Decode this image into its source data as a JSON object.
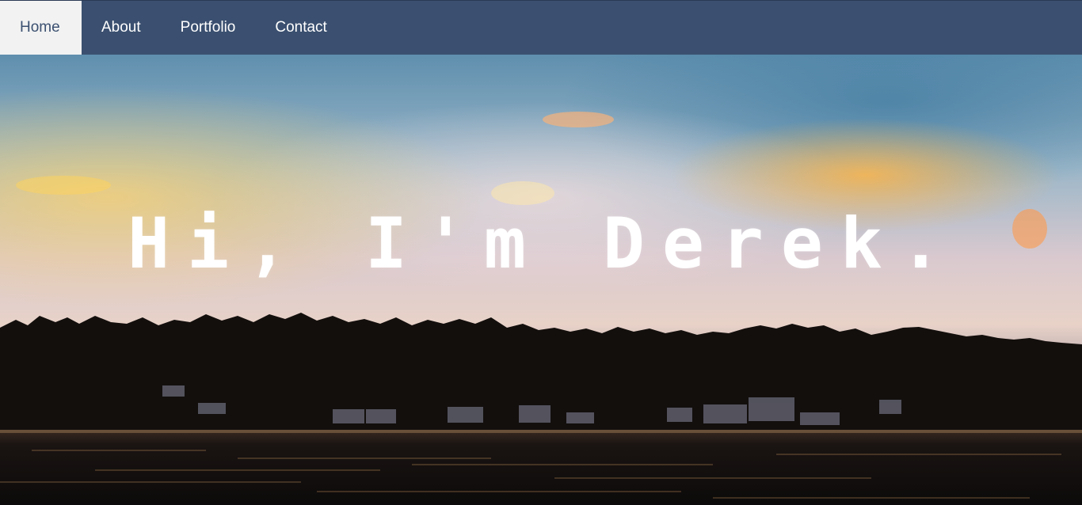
{
  "nav": {
    "items": [
      {
        "label": "Home",
        "active": true
      },
      {
        "label": "About",
        "active": false
      },
      {
        "label": "Portfolio",
        "active": false
      },
      {
        "label": "Contact",
        "active": false
      }
    ]
  },
  "hero": {
    "title": "Hi, I'm Derek."
  },
  "colors": {
    "navbar": "#3b5070",
    "active_tab_bg": "#f2f2f2",
    "nav_text": "#ffffff",
    "hero_text": "#ffffff"
  }
}
